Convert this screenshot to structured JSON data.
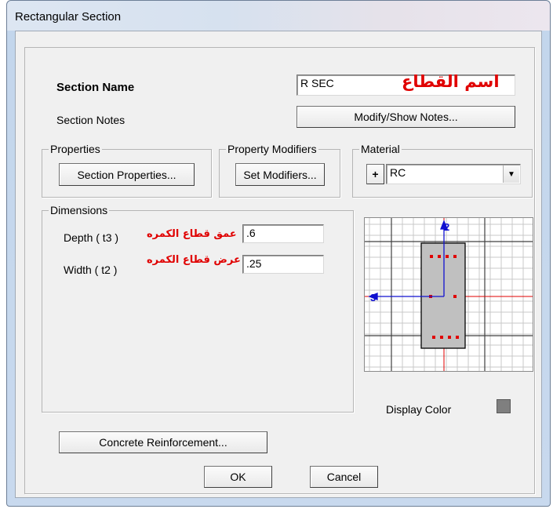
{
  "window": {
    "title": "Rectangular Section"
  },
  "section": {
    "name_label": "Section Name",
    "name_value": "R SEC",
    "name_annotation": "اسم القطاع",
    "notes_label": "Section Notes",
    "notes_button": "Modify/Show Notes..."
  },
  "properties": {
    "legend": "Properties",
    "button": "Section Properties..."
  },
  "modifiers": {
    "legend": "Property Modifiers",
    "button": "Set Modifiers..."
  },
  "material": {
    "legend": "Material",
    "add_button": "+",
    "selected": "RC"
  },
  "dimensions": {
    "legend": "Dimensions",
    "depth_label": "Depth  ( t3 )",
    "depth_value": ".6",
    "depth_annotation": "عمق قطاع الكمره",
    "width_label": "Width  ( t2 )",
    "width_value": ".25",
    "width_annotation": "عرض قطاع الكمره"
  },
  "preview": {
    "axis_vertical": "2",
    "axis_horizontal": "3",
    "display_color_label": "Display Color",
    "display_color": "#808080"
  },
  "buttons": {
    "reinforcement": "Concrete Reinforcement...",
    "ok": "OK",
    "cancel": "Cancel"
  },
  "colors": {
    "rebar": "#e00000",
    "axis": "#1010d0",
    "section_fill": "#c0c0c0",
    "annotation": "#e00000"
  }
}
